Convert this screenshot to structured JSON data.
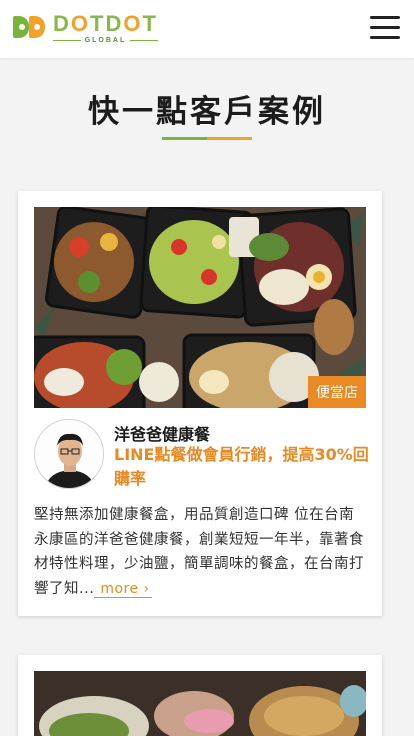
{
  "header": {
    "logo_name_part1": "D",
    "logo_name_o1": "O",
    "logo_name_part2": "TD",
    "logo_name_o2": "O",
    "logo_name_part3": "T",
    "logo_subtitle": "GLOBAL",
    "menu_icon": "hamburger-menu-icon"
  },
  "page": {
    "title": "快一點客戶案例"
  },
  "cases": [
    {
      "tag": "便當店",
      "name": "洋爸爸健康餐",
      "headline": "LINE點餐做會員行銷，提高30%回購率",
      "description": "堅持無添加健康餐盒，用品質創造口碑 位在台南永康區的洋爸爸健康餐，創業短短一年半，靠著食材特性料理，少油鹽，簡單調味的餐盒，在台南打響了知...",
      "more_label": "more ›"
    }
  ],
  "colors": {
    "brand_green": "#7ab53b",
    "brand_orange": "#f2a12b",
    "accent_orange": "#e98a25"
  }
}
